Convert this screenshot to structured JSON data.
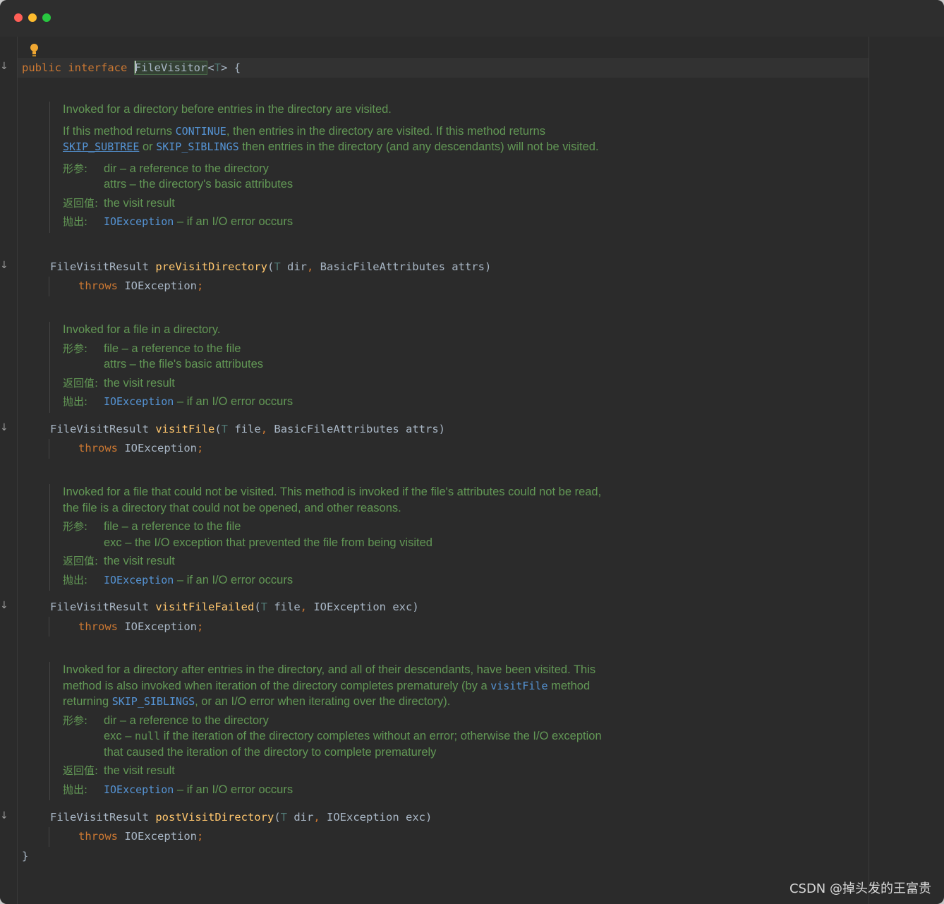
{
  "window": {
    "traffic_lights": [
      "close",
      "minimize",
      "zoom"
    ],
    "colors": {
      "background": "#2b2b2b",
      "keyword": "#cc7832",
      "function": "#ffc66d",
      "doc": "#629755",
      "link": "#5594d5",
      "highlight": "#344134"
    }
  },
  "gutter": {
    "marker": "↓",
    "bulb_icon": "lightbulb-icon"
  },
  "code": {
    "public_kw": "public",
    "interface_kw": "interface",
    "interface_name": "FileVisitor",
    "type_param_open": "<",
    "type_param": "T",
    "type_param_close": ">",
    "open_brace": " {",
    "close_brace": "}"
  },
  "labels": {
    "params": "形参:",
    "returns": "返回值:",
    "throws_tag": "抛出:",
    "throws_kw": "throws",
    "ioexception": "IOException",
    "return_text": "the visit result",
    "throws_text": " – if an I/O error occurs",
    "return_type": "FileVisitResult"
  },
  "methods": [
    {
      "name": "preVisitDirectory",
      "doc_p1": "Invoked for a directory before entries in the directory are visited.",
      "doc_p2_a": "If this method returns ",
      "doc_p2_continue": "CONTINUE",
      "doc_p2_b": ", then entries in the directory are visited. If this method returns ",
      "doc_p2_skip_subtree": "SKIP_SUBTREE",
      "doc_p2_c": " or ",
      "doc_p2_skip_siblings": "SKIP_SIBLINGS",
      "doc_p2_d": " then entries in the directory (and any descendants) will not be visited.",
      "param1": "dir – a reference to the directory",
      "param2": "attrs – the directory's basic attributes",
      "sig_params": [
        "T",
        " dir",
        ", ",
        "BasicFileAttributes attrs)"
      ]
    },
    {
      "name": "visitFile",
      "doc_p1": "Invoked for a file in a directory.",
      "param1": "file – a reference to the file",
      "param2": "attrs – the file's basic attributes",
      "sig_params": [
        "T",
        " file",
        ", ",
        "BasicFileAttributes attrs)"
      ]
    },
    {
      "name": "visitFileFailed",
      "doc_p1": "Invoked for a file that could not be visited. This method is invoked if the file's attributes could not be read, the file is a directory that could not be opened, and other reasons.",
      "param1": "file – a reference to the file",
      "param2": "exc – the I/O exception that prevented the file from being visited",
      "sig_params": [
        "T",
        " file",
        ", ",
        "IOException exc)"
      ]
    },
    {
      "name": "postVisitDirectory",
      "doc_p1_a": "Invoked for a directory after entries in the directory, and all of their descendants, have been visited. This method is also invoked when iteration of the directory completes prematurely (by a ",
      "doc_p1_visitfile": "visitFile",
      "doc_p1_b": " method returning ",
      "doc_p1_skip_siblings": "SKIP_SIBLINGS",
      "doc_p1_c": ", or an I/O error when iterating over the directory).",
      "param1": "dir – a reference to the directory",
      "param2_a": "exc – ",
      "param2_null": "null",
      "param2_b": " if the iteration of the directory completes without an error; otherwise the I/O exception that caused the iteration of the directory to complete prematurely",
      "sig_params": [
        "T",
        " dir",
        ", ",
        "IOException exc)"
      ]
    }
  ],
  "watermark": "CSDN @掉头发的王富贵"
}
